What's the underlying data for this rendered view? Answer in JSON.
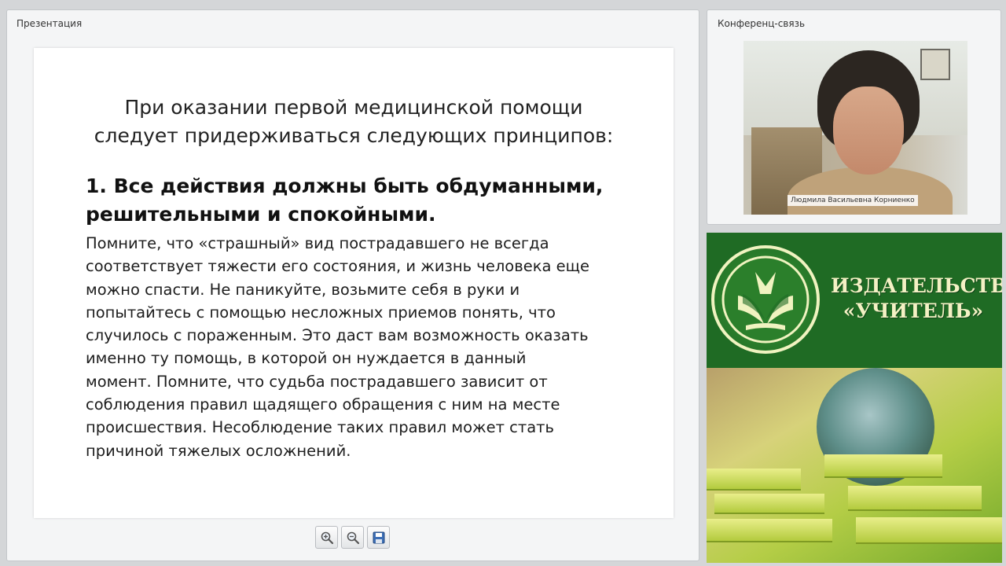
{
  "presentation": {
    "title": "Презентация",
    "slide": {
      "heading_lines": [
        "При оказании первой медицинской помощи",
        "следует придерживаться следующих принципов:"
      ],
      "principle_lines": [
        "1. Все действия должны быть обдуманными,",
        "решительными и спокойными."
      ],
      "body_lines": [
        "Помните, что «страшный» вид пострадавшего не всегда",
        "соответствует тяжести его состояния, и жизнь человека еще",
        "можно спасти. Не паникуйте, возьмите себя в руки и",
        "попытайтесь с помощью несложных приемов понять, что",
        "случилось с пораженным. Это даст вам возможность оказать",
        "именно ту помощь, в которой он нуждается в данный",
        "момент. Помните, что судьба пострадавшего зависит от",
        "соблюдения правил щадящего обращения с ним на месте",
        "происшествия. Несоблюдение таких правил может стать",
        "причиной тяжелых осложнений."
      ]
    },
    "toolbar": {
      "zoom_in_icon": "zoom-in-icon",
      "zoom_out_icon": "zoom-out-icon",
      "save_icon": "save-icon"
    }
  },
  "conference": {
    "title": "Конференц-связь",
    "participant_name": "Людмила Васильевна Корниенко"
  },
  "publisher": {
    "name_lines": [
      "ИЗДАТЕЛЬСТВО",
      "«УЧИТЕЛЬ»"
    ],
    "brand_green": "#1f6b24",
    "logo_color": "#f0f3c0"
  }
}
